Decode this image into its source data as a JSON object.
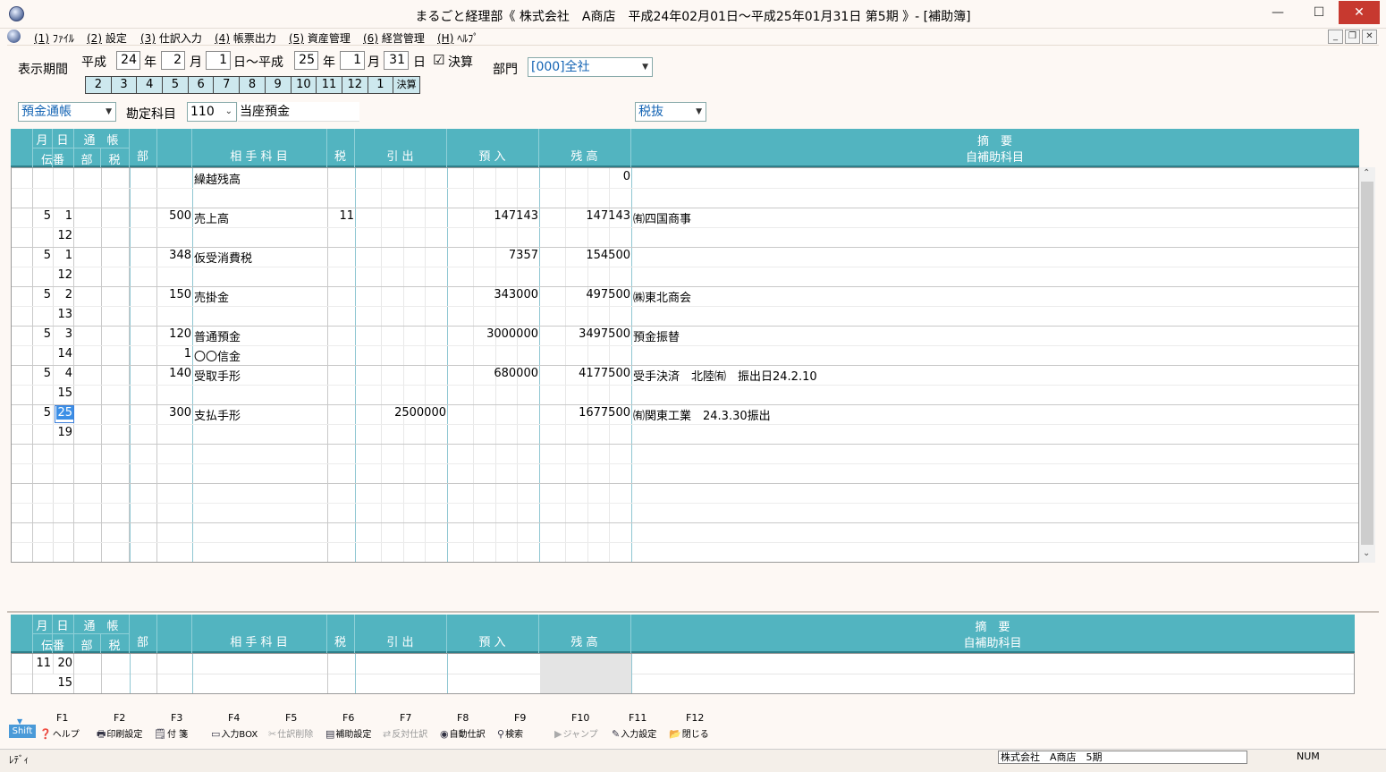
{
  "window": {
    "title": "まるごと経理部《 株式会社　A商店　平成24年02月01日～平成25年01月31日 第5期 》- [補助簿]",
    "minimize": "—",
    "maximize": "☐",
    "close": "✕"
  },
  "menu": [
    {
      "key": "(1)",
      "label": "ﾌｧｲﾙ"
    },
    {
      "key": "(2)",
      "label": "設定"
    },
    {
      "key": "(3)",
      "label": "仕訳入力"
    },
    {
      "key": "(4)",
      "label": "帳票出力"
    },
    {
      "key": "(5)",
      "label": "資産管理"
    },
    {
      "key": "(6)",
      "label": "経営管理"
    },
    {
      "key": "(H)",
      "label": "ﾍﾙﾌﾟ"
    }
  ],
  "mdi": {
    "minimize": "_",
    "restore": "❐",
    "close": "✕"
  },
  "filter": {
    "period_label": "表示期間",
    "era1": "平成",
    "year1": "24",
    "nen1": "年",
    "month1": "2",
    "gatsu1": "月",
    "day1": "1",
    "hi_kara": "日～平成",
    "year2": "25",
    "nen2": "年",
    "month2": "1",
    "gatsu2": "月",
    "day2": "31",
    "hi2": "日",
    "closing_checkbox": "☑",
    "closing_label": "決算",
    "dept_label": "部門",
    "dept_value": "[000]全社",
    "months": [
      "2",
      "3",
      "4",
      "5",
      "6",
      "7",
      "8",
      "9",
      "10",
      "11",
      "12",
      "1",
      "決算"
    ],
    "book_type": "預金通帳",
    "account_label": "勘定科目",
    "account_code": "110",
    "account_name": "当座預金",
    "tax_mode": "税抜"
  },
  "header": {
    "month": "月",
    "day": "日",
    "passbook": "通　帳",
    "voucher": "伝番",
    "dept_small": "部",
    "tax_small": "税",
    "dept": "部",
    "counter_account": "相 手 科 目",
    "tax": "税",
    "withdraw": "引 出",
    "deposit": "預 入",
    "balance": "残 高",
    "memo": "摘　要",
    "sub_account": "自補助科目"
  },
  "rows": [
    {
      "m": "",
      "d": "",
      "voucher": "",
      "code": "",
      "account": "繰越残高",
      "sub_code": "",
      "sub_name": "",
      "tax": "",
      "withdraw": "",
      "deposit": "",
      "balance": "0",
      "memo": ""
    },
    {
      "m": "5",
      "d": "1",
      "voucher": "12",
      "code": "500",
      "account": "売上高",
      "sub_code": "",
      "sub_name": "",
      "tax": "11",
      "withdraw": "",
      "deposit": "147143",
      "balance": "147143",
      "memo": "㈲四国商事"
    },
    {
      "m": "5",
      "d": "1",
      "voucher": "12",
      "code": "348",
      "account": "仮受消費税",
      "sub_code": "",
      "sub_name": "",
      "tax": "",
      "withdraw": "",
      "deposit": "7357",
      "balance": "154500",
      "memo": ""
    },
    {
      "m": "5",
      "d": "2",
      "voucher": "13",
      "code": "150",
      "account": "売掛金",
      "sub_code": "",
      "sub_name": "",
      "tax": "",
      "withdraw": "",
      "deposit": "343000",
      "balance": "497500",
      "memo": "㈱東北商会"
    },
    {
      "m": "5",
      "d": "3",
      "voucher": "14",
      "code": "120",
      "account": "普通預金",
      "sub_code": "1",
      "sub_name": "〇〇信金",
      "tax": "",
      "withdraw": "",
      "deposit": "3000000",
      "balance": "3497500",
      "memo": "預金振替"
    },
    {
      "m": "5",
      "d": "4",
      "voucher": "15",
      "code": "140",
      "account": "受取手形",
      "sub_code": "",
      "sub_name": "",
      "tax": "",
      "withdraw": "",
      "deposit": "680000",
      "balance": "4177500",
      "memo": "受手決済　北陸㈲　振出日24.2.10"
    },
    {
      "m": "5",
      "d": "25",
      "voucher": "19",
      "code": "300",
      "account": "支払手形",
      "sub_code": "",
      "sub_name": "",
      "tax": "",
      "withdraw": "2500000",
      "deposit": "",
      "balance": "1677500",
      "memo": "㈲関東工業　24.3.30振出"
    }
  ],
  "input_row": {
    "m": "11",
    "d": "20",
    "voucher": "15"
  },
  "fkeys": [
    {
      "key": "F1",
      "label": "ヘルプ",
      "icon": "question-icon",
      "enabled": true
    },
    {
      "key": "F2",
      "label": "印刷設定",
      "icon": "printer-icon",
      "enabled": true
    },
    {
      "key": "F3",
      "label": "付 箋",
      "icon": "sticky-note-icon",
      "enabled": true
    },
    {
      "key": "F4",
      "label": "入力BOX",
      "icon": "input-box-icon",
      "enabled": true
    },
    {
      "key": "F5",
      "label": "仕訳削除",
      "icon": "scissors-icon",
      "enabled": false
    },
    {
      "key": "F6",
      "label": "補助設定",
      "icon": "settings-list-icon",
      "enabled": true
    },
    {
      "key": "F7",
      "label": "反対仕訳",
      "icon": "reverse-icon",
      "enabled": false
    },
    {
      "key": "F8",
      "label": "自動仕訳",
      "icon": "auto-journal-icon",
      "enabled": true
    },
    {
      "key": "F9",
      "label": "検索",
      "icon": "binoculars-icon",
      "enabled": true
    },
    {
      "key": "F10",
      "label": "ジャンプ",
      "icon": "jump-icon",
      "enabled": false
    },
    {
      "key": "F11",
      "label": "入力設定",
      "icon": "edit-settings-icon",
      "enabled": true
    },
    {
      "key": "F12",
      "label": "閉じる",
      "icon": "folder-close-icon",
      "enabled": true
    }
  ],
  "shift_label": "Shift",
  "status": {
    "left": "ﾚﾃﾞｨ",
    "company": "株式会社　A商店　5期",
    "num": "NUM"
  }
}
